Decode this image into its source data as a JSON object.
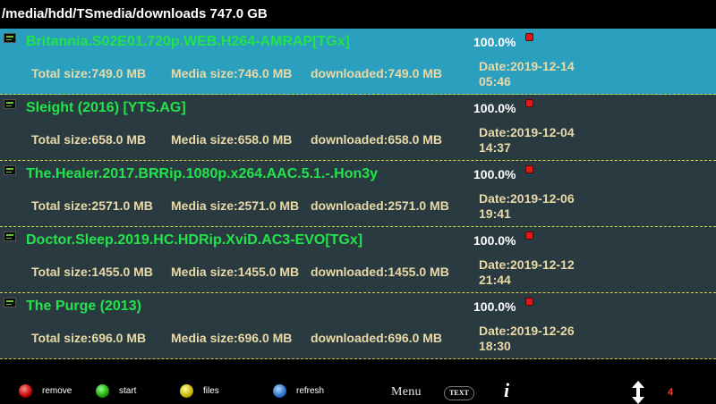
{
  "path": "/media/hdd/TSmedia/downloads 747.0 GB",
  "items": [
    {
      "name": "Britannia.S02E01.720p.WEB.H264-AMRAP[TGx]",
      "percent": "100.0%",
      "total": "Total size:749.0 MB",
      "media": "Media size:746.0 MB",
      "downloaded": "downloaded:749.0 MB",
      "date": "Date:2019-12-14",
      "time": "05:46"
    },
    {
      "name": "Sleight (2016) [YTS.AG]",
      "percent": "100.0%",
      "total": "Total size:658.0 MB",
      "media": "Media size:658.0 MB",
      "downloaded": "downloaded:658.0 MB",
      "date": "Date:2019-12-04",
      "time": "14:37"
    },
    {
      "name": "The.Healer.2017.BRRip.1080p.x264.AAC.5.1.-.Hon3y",
      "percent": "100.0%",
      "total": "Total size:2571.0 MB",
      "media": "Media size:2571.0 MB",
      "downloaded": "downloaded:2571.0 MB",
      "date": "Date:2019-12-06",
      "time": "19:41"
    },
    {
      "name": "Doctor.Sleep.2019.HC.HDRip.XviD.AC3-EVO[TGx]",
      "percent": "100.0%",
      "total": "Total size:1455.0 MB",
      "media": "Media size:1455.0 MB",
      "downloaded": "downloaded:1455.0 MB",
      "date": "Date:2019-12-12",
      "time": "21:44"
    },
    {
      "name": "The Purge (2013)",
      "percent": "100.0%",
      "total": "Total size:696.0 MB",
      "media": "Media size:696.0 MB",
      "downloaded": "downloaded:696.0 MB",
      "date": "Date:2019-12-26",
      "time": "18:30"
    }
  ],
  "selected_index": 0,
  "footer": {
    "remove": "remove",
    "start": "start",
    "files": "files",
    "refresh": "refresh",
    "menu": "Menu",
    "text": "TEXT",
    "info": "i",
    "page": "4"
  },
  "colors": {
    "list_bg": "#2a3a41",
    "selected_bg": "#2b9fbe",
    "name_text": "#22e34a",
    "info_text": "#e9d9a7",
    "divider": "#d6d24a",
    "page_num": "#ff3a3a"
  },
  "icons": {
    "file": "video-file-icon",
    "status": "red-square-icon",
    "red": "red-button-icon",
    "green": "green-button-icon",
    "yellow": "yellow-button-icon",
    "blue": "blue-button-icon",
    "updown": "up-down-arrow-icon"
  }
}
